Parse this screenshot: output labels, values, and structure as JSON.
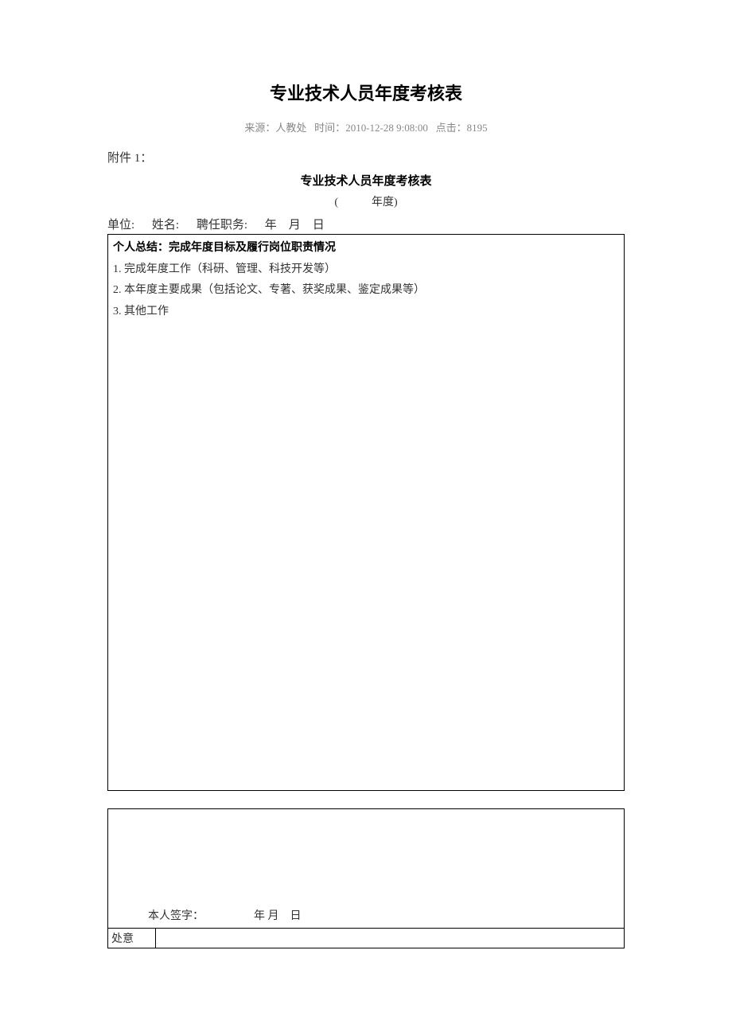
{
  "title": "专业技术人员年度考核表",
  "meta": {
    "source_label": "来源：",
    "source_value": "人教处",
    "time_label": "时间：",
    "time_value": "2010-12-28 9:08:00",
    "hits_label": "点击：",
    "hits_value": "8195"
  },
  "attachment_label": "附件 1：",
  "form_title": "专业技术人员年度考核表",
  "year_line": "(　　　年度)",
  "info": {
    "unit_label": "单位:",
    "name_label": "姓名:",
    "position_label": "聘任职务:",
    "date_label": "年　月　日"
  },
  "summary": {
    "header": "个人总结：完成年度目标及履行岗位职责情况",
    "item1": "1. 完成年度工作（科研、管理、科技开发等）",
    "item2": "2. 本年度主要成果（包括论文、专著、获奖成果、鉴定成果等）",
    "item3": "3. 其他工作"
  },
  "signature": {
    "self_sign": "本人签字：",
    "date": "年  月　日",
    "dept_opinion": "处意"
  }
}
